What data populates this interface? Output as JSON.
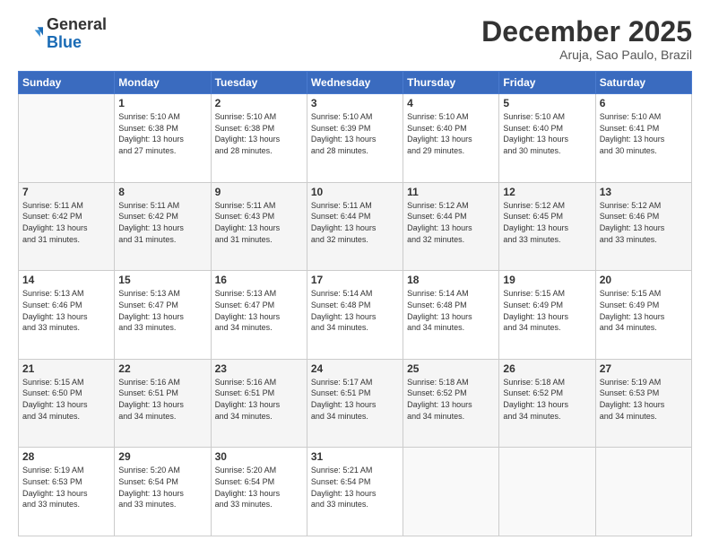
{
  "logo": {
    "general": "General",
    "blue": "Blue"
  },
  "header": {
    "month": "December 2025",
    "location": "Aruja, Sao Paulo, Brazil"
  },
  "days_of_week": [
    "Sunday",
    "Monday",
    "Tuesday",
    "Wednesday",
    "Thursday",
    "Friday",
    "Saturday"
  ],
  "weeks": [
    [
      {
        "day": "",
        "info": ""
      },
      {
        "day": "1",
        "info": "Sunrise: 5:10 AM\nSunset: 6:38 PM\nDaylight: 13 hours\nand 27 minutes."
      },
      {
        "day": "2",
        "info": "Sunrise: 5:10 AM\nSunset: 6:38 PM\nDaylight: 13 hours\nand 28 minutes."
      },
      {
        "day": "3",
        "info": "Sunrise: 5:10 AM\nSunset: 6:39 PM\nDaylight: 13 hours\nand 28 minutes."
      },
      {
        "day": "4",
        "info": "Sunrise: 5:10 AM\nSunset: 6:40 PM\nDaylight: 13 hours\nand 29 minutes."
      },
      {
        "day": "5",
        "info": "Sunrise: 5:10 AM\nSunset: 6:40 PM\nDaylight: 13 hours\nand 30 minutes."
      },
      {
        "day": "6",
        "info": "Sunrise: 5:10 AM\nSunset: 6:41 PM\nDaylight: 13 hours\nand 30 minutes."
      }
    ],
    [
      {
        "day": "7",
        "info": "Sunrise: 5:11 AM\nSunset: 6:42 PM\nDaylight: 13 hours\nand 31 minutes."
      },
      {
        "day": "8",
        "info": "Sunrise: 5:11 AM\nSunset: 6:42 PM\nDaylight: 13 hours\nand 31 minutes."
      },
      {
        "day": "9",
        "info": "Sunrise: 5:11 AM\nSunset: 6:43 PM\nDaylight: 13 hours\nand 31 minutes."
      },
      {
        "day": "10",
        "info": "Sunrise: 5:11 AM\nSunset: 6:44 PM\nDaylight: 13 hours\nand 32 minutes."
      },
      {
        "day": "11",
        "info": "Sunrise: 5:12 AM\nSunset: 6:44 PM\nDaylight: 13 hours\nand 32 minutes."
      },
      {
        "day": "12",
        "info": "Sunrise: 5:12 AM\nSunset: 6:45 PM\nDaylight: 13 hours\nand 33 minutes."
      },
      {
        "day": "13",
        "info": "Sunrise: 5:12 AM\nSunset: 6:46 PM\nDaylight: 13 hours\nand 33 minutes."
      }
    ],
    [
      {
        "day": "14",
        "info": "Sunrise: 5:13 AM\nSunset: 6:46 PM\nDaylight: 13 hours\nand 33 minutes."
      },
      {
        "day": "15",
        "info": "Sunrise: 5:13 AM\nSunset: 6:47 PM\nDaylight: 13 hours\nand 33 minutes."
      },
      {
        "day": "16",
        "info": "Sunrise: 5:13 AM\nSunset: 6:47 PM\nDaylight: 13 hours\nand 34 minutes."
      },
      {
        "day": "17",
        "info": "Sunrise: 5:14 AM\nSunset: 6:48 PM\nDaylight: 13 hours\nand 34 minutes."
      },
      {
        "day": "18",
        "info": "Sunrise: 5:14 AM\nSunset: 6:48 PM\nDaylight: 13 hours\nand 34 minutes."
      },
      {
        "day": "19",
        "info": "Sunrise: 5:15 AM\nSunset: 6:49 PM\nDaylight: 13 hours\nand 34 minutes."
      },
      {
        "day": "20",
        "info": "Sunrise: 5:15 AM\nSunset: 6:49 PM\nDaylight: 13 hours\nand 34 minutes."
      }
    ],
    [
      {
        "day": "21",
        "info": "Sunrise: 5:15 AM\nSunset: 6:50 PM\nDaylight: 13 hours\nand 34 minutes."
      },
      {
        "day": "22",
        "info": "Sunrise: 5:16 AM\nSunset: 6:51 PM\nDaylight: 13 hours\nand 34 minutes."
      },
      {
        "day": "23",
        "info": "Sunrise: 5:16 AM\nSunset: 6:51 PM\nDaylight: 13 hours\nand 34 minutes."
      },
      {
        "day": "24",
        "info": "Sunrise: 5:17 AM\nSunset: 6:51 PM\nDaylight: 13 hours\nand 34 minutes."
      },
      {
        "day": "25",
        "info": "Sunrise: 5:18 AM\nSunset: 6:52 PM\nDaylight: 13 hours\nand 34 minutes."
      },
      {
        "day": "26",
        "info": "Sunrise: 5:18 AM\nSunset: 6:52 PM\nDaylight: 13 hours\nand 34 minutes."
      },
      {
        "day": "27",
        "info": "Sunrise: 5:19 AM\nSunset: 6:53 PM\nDaylight: 13 hours\nand 34 minutes."
      }
    ],
    [
      {
        "day": "28",
        "info": "Sunrise: 5:19 AM\nSunset: 6:53 PM\nDaylight: 13 hours\nand 33 minutes."
      },
      {
        "day": "29",
        "info": "Sunrise: 5:20 AM\nSunset: 6:54 PM\nDaylight: 13 hours\nand 33 minutes."
      },
      {
        "day": "30",
        "info": "Sunrise: 5:20 AM\nSunset: 6:54 PM\nDaylight: 13 hours\nand 33 minutes."
      },
      {
        "day": "31",
        "info": "Sunrise: 5:21 AM\nSunset: 6:54 PM\nDaylight: 13 hours\nand 33 minutes."
      },
      {
        "day": "",
        "info": ""
      },
      {
        "day": "",
        "info": ""
      },
      {
        "day": "",
        "info": ""
      }
    ]
  ]
}
